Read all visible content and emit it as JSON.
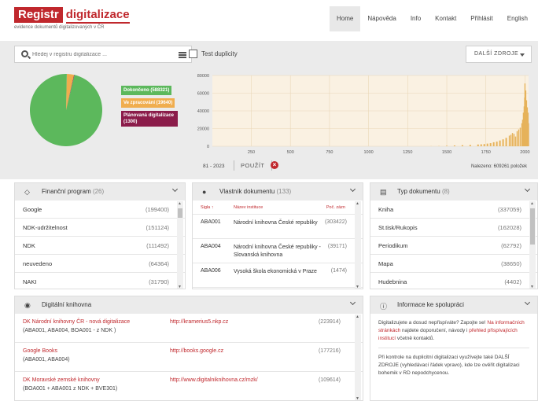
{
  "brand": {
    "logo_left": "Registr",
    "logo_right": "digitalizace",
    "tagline": "evidence dokumentů digitalizovaných v ČR",
    "accent": "#c0282d"
  },
  "nav": [
    "Home",
    "Nápověda",
    "Info",
    "Kontakt",
    "Přihlásit",
    "English"
  ],
  "search": {
    "placeholder": "Hledej v registru digitalizace ...",
    "duplicate_label": "Test duplicity",
    "more_sources": "DALŠÍ ZDROJE"
  },
  "status_legend": {
    "items": [
      {
        "label": "Dokončeno (588321)",
        "value": 588321,
        "color": "#5cb85c"
      },
      {
        "label": "Ve zpracování (19640)",
        "value": 19640,
        "color": "#f0ad4e"
      },
      {
        "label": "Plánovaná digitalizace (1300)",
        "value": 1300,
        "color": "#8b1c4a"
      }
    ]
  },
  "chart_data": {
    "type": "bar",
    "x": [
      1,
      100,
      200,
      300,
      400,
      500,
      600,
      700,
      800,
      900,
      1000,
      1100,
      1200,
      1300,
      1400,
      1450,
      1500,
      1550,
      1600,
      1650,
      1700,
      1720,
      1740,
      1760,
      1780,
      1800,
      1820,
      1840,
      1860,
      1880,
      1900,
      1910,
      1920,
      1930,
      1940,
      1950,
      1960,
      1970,
      1980,
      1985,
      1990,
      1995,
      1998,
      2000,
      2005,
      2010,
      2015,
      2020,
      2023
    ],
    "values": [
      0,
      0,
      0,
      0,
      0,
      0,
      0,
      0,
      0,
      0,
      0,
      0,
      0,
      0,
      100,
      200,
      500,
      900,
      1200,
      1500,
      2000,
      2200,
      2500,
      3000,
      3500,
      4500,
      5200,
      6500,
      7800,
      9500,
      12000,
      13000,
      15000,
      14000,
      11000,
      17000,
      19000,
      21000,
      26000,
      30000,
      38000,
      45000,
      55000,
      71000,
      63000,
      52000,
      44000,
      38000,
      26000
    ],
    "x_ticks": [
      250,
      500,
      750,
      1000,
      1250,
      1500,
      1750,
      2000
    ],
    "y_ticks": [
      0,
      20000,
      40000,
      60000,
      80000
    ],
    "xlim": [
      1,
      2023
    ],
    "ylim": [
      0,
      80000
    ],
    "color": "#e6b25a",
    "range_label": "81 - 2023",
    "apply_label": "POUŽÍT",
    "found_label": "Nalezeno: 609261 položek"
  },
  "financni": {
    "title": "Finanční program",
    "count": "(26)",
    "items": [
      {
        "label": "Google",
        "value": "(199400)"
      },
      {
        "label": "NDK-udržitelnost",
        "value": "(151124)"
      },
      {
        "label": "NDK",
        "value": "(111492)"
      },
      {
        "label": "neuvedeno",
        "value": "(64364)"
      },
      {
        "label": "NAKI",
        "value": "(31790)"
      }
    ]
  },
  "vlastnik": {
    "title": "Vlastník dokumentu",
    "count": "(133)",
    "headers": {
      "sigla": "Sigla ↑",
      "nazev": "Název instituce",
      "pocet": "Poč. zázn"
    },
    "items": [
      {
        "sigla": "ABA001",
        "nazev": "Národní knihovna České republiky",
        "pocet": "(303422)"
      },
      {
        "sigla": "ABA004",
        "nazev": "Národní knihovna České republiky - Slovanská knihovna",
        "pocet": "(39171)"
      },
      {
        "sigla": "ABA006",
        "nazev": "Vysoká škola ekonomická v Praze",
        "pocet": "(1474)"
      }
    ]
  },
  "typ": {
    "title": "Typ dokumentu",
    "count": "(8)",
    "items": [
      {
        "label": "Kniha",
        "value": "(337059)"
      },
      {
        "label": "St.tisk/Rukopis",
        "value": "(162028)"
      },
      {
        "label": "Periodikum",
        "value": "(62792)"
      },
      {
        "label": "Mapa",
        "value": "(38650)"
      },
      {
        "label": "Hudebnina",
        "value": "(4402)"
      }
    ]
  },
  "knihovna": {
    "title": "Digitální knihovna",
    "items": [
      {
        "name": "DK Národní knihovny ČR - nová digitalizace",
        "sub": "(ABA001, ABA004, BOA001 - z NDK )",
        "url": "http://kramerius5.nkp.cz",
        "count": "(223914)"
      },
      {
        "name": "Google Books",
        "sub": "(ABA001, ABA004)",
        "url": "http://books.google.cz",
        "count": "(177216)"
      },
      {
        "name": "DK Moravské zemské knihovny",
        "sub": "(BOA001 + ABA001 z NDK + BVE301)",
        "url": "http://www.digitalniknihovna.cz/mzk/",
        "count": "(109614)"
      }
    ]
  },
  "spoluprace": {
    "title": "Informace ke spolupráci",
    "p1_a": "Digitalizujete a dosud nepřispíváte? Zapojte se! ",
    "p1_link1": "Na informačních stránkách",
    "p1_b": " najdete doporučení, návody i ",
    "p1_link2": "přehled přispívajících institucí",
    "p1_c": " včetně kontaktů.",
    "p2": "Při kontrole na duplicitní digitalizaci využívejte také DALŠÍ ZDROJE (vyhledávací řádek vpravo), kde lze ověřit digitalizaci bohemik v RD nepodchycenou."
  }
}
